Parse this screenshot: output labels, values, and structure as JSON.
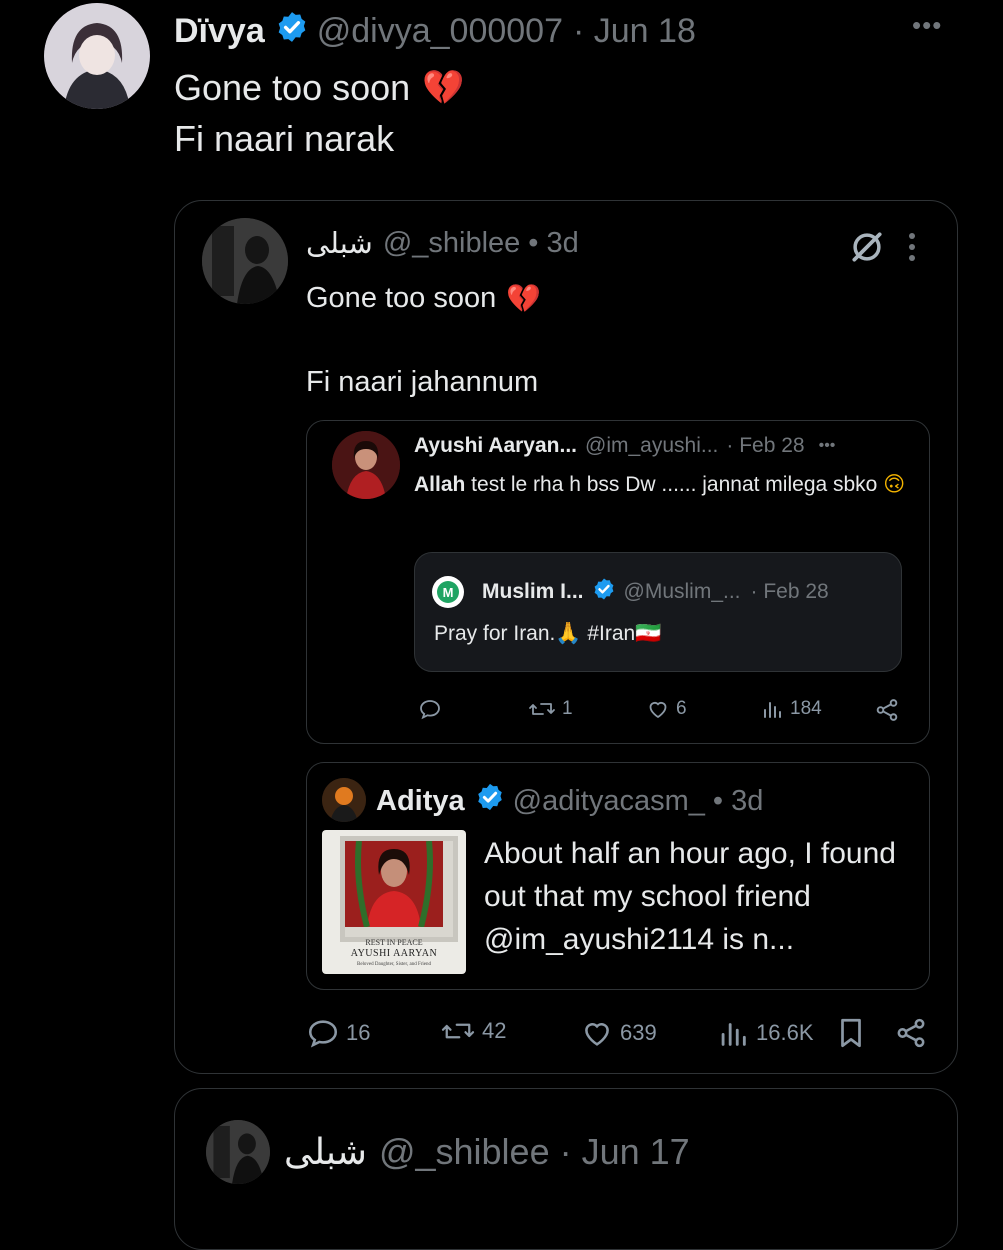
{
  "main_tweet": {
    "name": "Dïvya",
    "handle": "@divya_000007",
    "date": "· Jun 18",
    "line1": "Gone too soon",
    "line1_emoji": "💔",
    "line2": "Fi naari narak",
    "more": "•••"
  },
  "quote": {
    "name": "شبلى",
    "handle": "@_shiblee",
    "time": "• 3d",
    "line1": "Gone too soon",
    "line1_emoji": "💔",
    "line2": "Fi naari jahannum",
    "actions": {
      "replies": "16",
      "reposts": "42",
      "likes": "639",
      "views": "16.6K"
    }
  },
  "ayushi_tweet": {
    "name": "Ayushi Aaryan...",
    "handle": "@im_ayushi...",
    "date": "· Feb 28",
    "more": "•••",
    "text_bold": "Allah",
    "text_rest": " test le rha h bss Dw ...... jannat milega sbko",
    "emoji": "🙃",
    "actions": {
      "reposts": "1",
      "likes": "6",
      "views": "184"
    }
  },
  "muslim_tweet": {
    "avatar_letter": "M",
    "name": "Muslim I...",
    "handle": "@Muslim_...",
    "date": "· Feb 28",
    "text": "Pray for Iran.🙏 #Iran🇮🇷"
  },
  "aditya_tweet": {
    "name": "Aditya",
    "handle": "@adityacasm_",
    "time": "• 3d",
    "text": "About half an hour ago, I found out that my school friend @im_ayushi2114 is n...",
    "poster": {
      "line1": "REST IN PEACE",
      "line2": "AYUSHI AARYAN",
      "line3": "Beloved Daughter, Sister, and Friend"
    }
  },
  "next_tweet": {
    "name": "شبلى",
    "handle": "@_shiblee",
    "date": "· Jun 17"
  },
  "colors": {
    "verified": "#1d9bf0",
    "background": "#000000",
    "border": "#2f3336",
    "muted": "#71767b"
  }
}
